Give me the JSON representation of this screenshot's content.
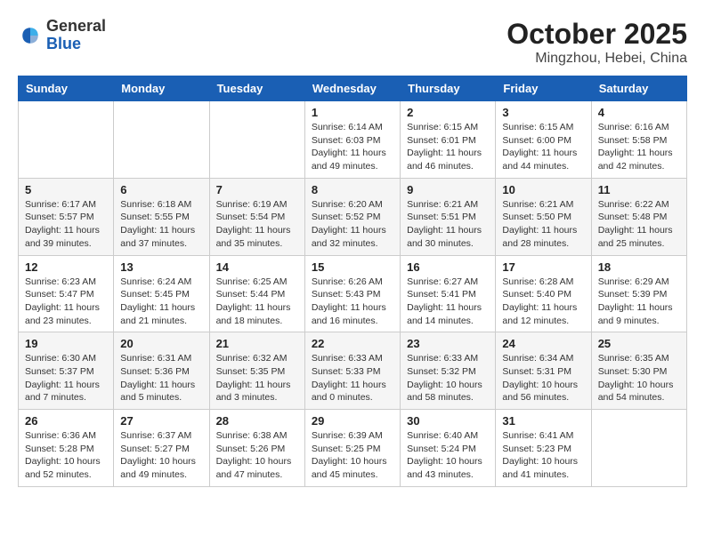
{
  "header": {
    "logo_general": "General",
    "logo_blue": "Blue",
    "month": "October 2025",
    "location": "Mingzhou, Hebei, China"
  },
  "weekdays": [
    "Sunday",
    "Monday",
    "Tuesday",
    "Wednesday",
    "Thursday",
    "Friday",
    "Saturday"
  ],
  "weeks": [
    [
      {
        "day": "",
        "info": ""
      },
      {
        "day": "",
        "info": ""
      },
      {
        "day": "",
        "info": ""
      },
      {
        "day": "1",
        "info": "Sunrise: 6:14 AM\nSunset: 6:03 PM\nDaylight: 11 hours\nand 49 minutes."
      },
      {
        "day": "2",
        "info": "Sunrise: 6:15 AM\nSunset: 6:01 PM\nDaylight: 11 hours\nand 46 minutes."
      },
      {
        "day": "3",
        "info": "Sunrise: 6:15 AM\nSunset: 6:00 PM\nDaylight: 11 hours\nand 44 minutes."
      },
      {
        "day": "4",
        "info": "Sunrise: 6:16 AM\nSunset: 5:58 PM\nDaylight: 11 hours\nand 42 minutes."
      }
    ],
    [
      {
        "day": "5",
        "info": "Sunrise: 6:17 AM\nSunset: 5:57 PM\nDaylight: 11 hours\nand 39 minutes."
      },
      {
        "day": "6",
        "info": "Sunrise: 6:18 AM\nSunset: 5:55 PM\nDaylight: 11 hours\nand 37 minutes."
      },
      {
        "day": "7",
        "info": "Sunrise: 6:19 AM\nSunset: 5:54 PM\nDaylight: 11 hours\nand 35 minutes."
      },
      {
        "day": "8",
        "info": "Sunrise: 6:20 AM\nSunset: 5:52 PM\nDaylight: 11 hours\nand 32 minutes."
      },
      {
        "day": "9",
        "info": "Sunrise: 6:21 AM\nSunset: 5:51 PM\nDaylight: 11 hours\nand 30 minutes."
      },
      {
        "day": "10",
        "info": "Sunrise: 6:21 AM\nSunset: 5:50 PM\nDaylight: 11 hours\nand 28 minutes."
      },
      {
        "day": "11",
        "info": "Sunrise: 6:22 AM\nSunset: 5:48 PM\nDaylight: 11 hours\nand 25 minutes."
      }
    ],
    [
      {
        "day": "12",
        "info": "Sunrise: 6:23 AM\nSunset: 5:47 PM\nDaylight: 11 hours\nand 23 minutes."
      },
      {
        "day": "13",
        "info": "Sunrise: 6:24 AM\nSunset: 5:45 PM\nDaylight: 11 hours\nand 21 minutes."
      },
      {
        "day": "14",
        "info": "Sunrise: 6:25 AM\nSunset: 5:44 PM\nDaylight: 11 hours\nand 18 minutes."
      },
      {
        "day": "15",
        "info": "Sunrise: 6:26 AM\nSunset: 5:43 PM\nDaylight: 11 hours\nand 16 minutes."
      },
      {
        "day": "16",
        "info": "Sunrise: 6:27 AM\nSunset: 5:41 PM\nDaylight: 11 hours\nand 14 minutes."
      },
      {
        "day": "17",
        "info": "Sunrise: 6:28 AM\nSunset: 5:40 PM\nDaylight: 11 hours\nand 12 minutes."
      },
      {
        "day": "18",
        "info": "Sunrise: 6:29 AM\nSunset: 5:39 PM\nDaylight: 11 hours\nand 9 minutes."
      }
    ],
    [
      {
        "day": "19",
        "info": "Sunrise: 6:30 AM\nSunset: 5:37 PM\nDaylight: 11 hours\nand 7 minutes."
      },
      {
        "day": "20",
        "info": "Sunrise: 6:31 AM\nSunset: 5:36 PM\nDaylight: 11 hours\nand 5 minutes."
      },
      {
        "day": "21",
        "info": "Sunrise: 6:32 AM\nSunset: 5:35 PM\nDaylight: 11 hours\nand 3 minutes."
      },
      {
        "day": "22",
        "info": "Sunrise: 6:33 AM\nSunset: 5:33 PM\nDaylight: 11 hours\nand 0 minutes."
      },
      {
        "day": "23",
        "info": "Sunrise: 6:33 AM\nSunset: 5:32 PM\nDaylight: 10 hours\nand 58 minutes."
      },
      {
        "day": "24",
        "info": "Sunrise: 6:34 AM\nSunset: 5:31 PM\nDaylight: 10 hours\nand 56 minutes."
      },
      {
        "day": "25",
        "info": "Sunrise: 6:35 AM\nSunset: 5:30 PM\nDaylight: 10 hours\nand 54 minutes."
      }
    ],
    [
      {
        "day": "26",
        "info": "Sunrise: 6:36 AM\nSunset: 5:28 PM\nDaylight: 10 hours\nand 52 minutes."
      },
      {
        "day": "27",
        "info": "Sunrise: 6:37 AM\nSunset: 5:27 PM\nDaylight: 10 hours\nand 49 minutes."
      },
      {
        "day": "28",
        "info": "Sunrise: 6:38 AM\nSunset: 5:26 PM\nDaylight: 10 hours\nand 47 minutes."
      },
      {
        "day": "29",
        "info": "Sunrise: 6:39 AM\nSunset: 5:25 PM\nDaylight: 10 hours\nand 45 minutes."
      },
      {
        "day": "30",
        "info": "Sunrise: 6:40 AM\nSunset: 5:24 PM\nDaylight: 10 hours\nand 43 minutes."
      },
      {
        "day": "31",
        "info": "Sunrise: 6:41 AM\nSunset: 5:23 PM\nDaylight: 10 hours\nand 41 minutes."
      },
      {
        "day": "",
        "info": ""
      }
    ]
  ]
}
